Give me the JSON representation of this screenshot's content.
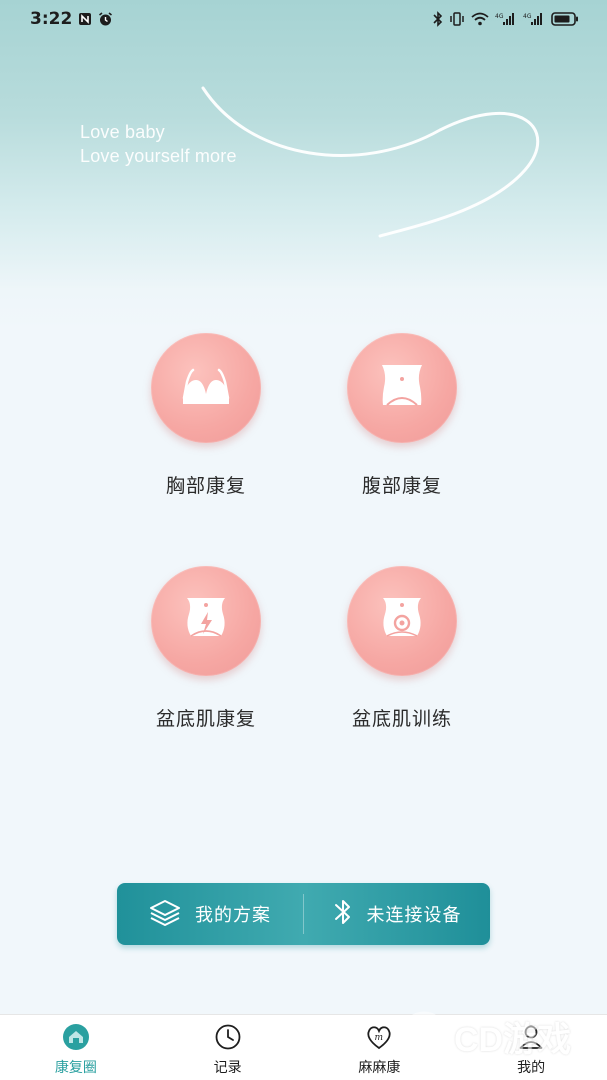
{
  "status_bar": {
    "time": "3:22"
  },
  "hero": {
    "line1": "Love baby",
    "line2": "Love yourself more"
  },
  "features": [
    {
      "label": "胸部康复",
      "icon": "bra-icon"
    },
    {
      "label": "腹部康复",
      "icon": "belly-icon"
    },
    {
      "label": "盆底肌康复",
      "icon": "pelvic-lightning-icon"
    },
    {
      "label": "盆底肌训练",
      "icon": "pelvic-target-icon"
    }
  ],
  "actions": {
    "plan_label": "我的方案",
    "device_label": "未连接设备"
  },
  "tabs": [
    {
      "label": "康复圈",
      "icon": "home-circle-icon",
      "active": true
    },
    {
      "label": "记录",
      "icon": "clock-icon",
      "active": false
    },
    {
      "label": "麻麻康",
      "icon": "heart-m-icon",
      "active": false
    },
    {
      "label": "我的",
      "icon": "user-icon",
      "active": false
    }
  ],
  "watermark": {
    "text": "CD游戏"
  },
  "colors": {
    "accent": "#20919a",
    "tile": "#f6a7a3",
    "active_tab": "#2aa0a0"
  }
}
